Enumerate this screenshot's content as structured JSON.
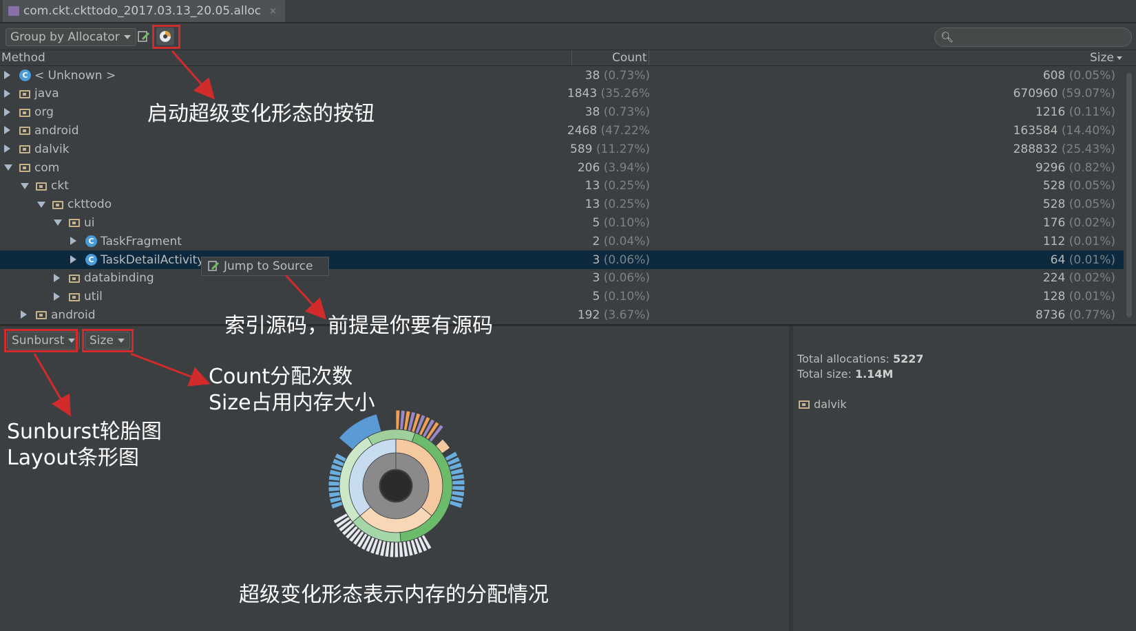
{
  "tab": {
    "title": "com.ckt.ckttodo_2017.03.13_20.05.alloc",
    "close": "×"
  },
  "toolbar": {
    "group_by": "Group by Allocator"
  },
  "columns": {
    "method": "Method",
    "count": "Count",
    "size": "Size"
  },
  "rows": [
    {
      "name": "< Unknown >",
      "count": "38",
      "count_pct": "(0.73%)",
      "size": "608",
      "size_pct": "(0.05%)",
      "icon": "class-icon"
    },
    {
      "name": "java",
      "count": "1843",
      "count_pct": "(35.26%",
      "size": "670960",
      "size_pct": "(59.07%)",
      "icon": "folder-icon"
    },
    {
      "name": "org",
      "count": "38",
      "count_pct": "(0.73%)",
      "size": "1216",
      "size_pct": "(0.11%)",
      "icon": "folder-icon"
    },
    {
      "name": "android",
      "count": "2468",
      "count_pct": "(47.22%",
      "size": "163584",
      "size_pct": "(14.40%)",
      "icon": "folder-icon"
    },
    {
      "name": "dalvik",
      "count": "589",
      "count_pct": "(11.27%)",
      "size": "288832",
      "size_pct": "(25.43%)",
      "icon": "folder-icon"
    },
    {
      "name": "com",
      "count": "206",
      "count_pct": "(3.94%)",
      "size": "9296",
      "size_pct": "(0.82%)",
      "icon": "folder-icon"
    },
    {
      "name": "ckt",
      "count": "13",
      "count_pct": "(0.25%)",
      "size": "528",
      "size_pct": "(0.05%)",
      "icon": "folder-icon"
    },
    {
      "name": "ckttodo",
      "count": "13",
      "count_pct": "(0.25%)",
      "size": "528",
      "size_pct": "(0.05%)",
      "icon": "folder-icon"
    },
    {
      "name": "ui",
      "count": "5",
      "count_pct": "(0.10%)",
      "size": "176",
      "size_pct": "(0.02%)",
      "icon": "folder-icon"
    },
    {
      "name": "TaskFragment",
      "count": "2",
      "count_pct": "(0.04%)",
      "size": "112",
      "size_pct": "(0.01%)",
      "icon": "class-icon"
    },
    {
      "name": "TaskDetailActivity",
      "count": "3",
      "count_pct": "(0.06%)",
      "size": "64",
      "size_pct": "(0.01%)",
      "icon": "class-icon",
      "selected": true
    },
    {
      "name": "databinding",
      "count": "3",
      "count_pct": "(0.06%)",
      "size": "224",
      "size_pct": "(0.02%)",
      "icon": "folder-icon"
    },
    {
      "name": "util",
      "count": "5",
      "count_pct": "(0.10%)",
      "size": "128",
      "size_pct": "(0.01%)",
      "icon": "folder-icon"
    },
    {
      "name": "android",
      "count": "192",
      "count_pct": "(3.67%)",
      "size": "8736",
      "size_pct": "(0.77%)",
      "icon": "folder-icon"
    }
  ],
  "popup": {
    "label": "Jump to Source"
  },
  "bottom": {
    "chart_type": "Sunburst",
    "metric": "Size"
  },
  "summary": {
    "total_allocations_label": "Total allocations:",
    "total_allocations_value": "5227",
    "total_size_label": "Total size:",
    "total_size_value": "1.14M",
    "selected_node": "dalvik"
  },
  "annotations": {
    "a1": "启动超级变化形态的按钮",
    "a2": "索引源码，前提是你要有源码",
    "a3_line1": "Count分配次数",
    "a3_line2": "Size占用内存大小",
    "a4_line1": "Sunburst轮胎图",
    "a4_line2": "Layout条形图",
    "a5": "超级变化形态表示内存的分配情况"
  },
  "colors": {
    "selection": "#0d293e",
    "annotation_red": "#d12b2b",
    "class_icon": "#4a9bd8",
    "folder": "#c8b48a"
  }
}
